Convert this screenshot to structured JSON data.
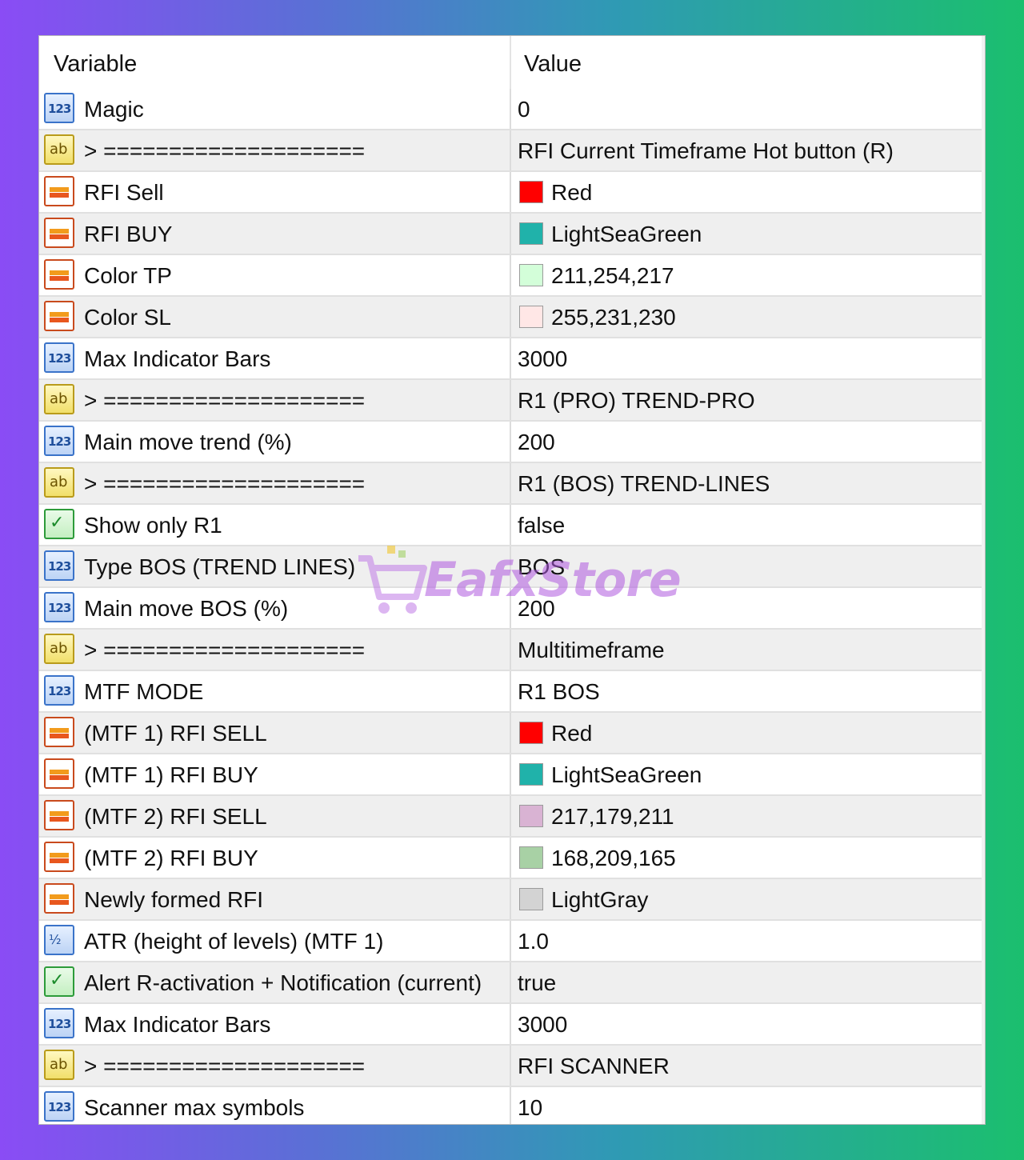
{
  "header": {
    "variable": "Variable",
    "value": "Value"
  },
  "rows": [
    {
      "type": "num",
      "label": "Magic",
      "value": "0"
    },
    {
      "type": "str",
      "label": "> ====================",
      "value": "RFI Current Timeframe Hot button (R)"
    },
    {
      "type": "clr",
      "label": "RFI Sell",
      "value": "Red",
      "swatch": "#ff0000"
    },
    {
      "type": "clr",
      "label": "RFI BUY",
      "value": "LightSeaGreen",
      "swatch": "#20b2aa"
    },
    {
      "type": "clr",
      "label": "Color TP",
      "value": "211,254,217",
      "swatch": "#d3fed9"
    },
    {
      "type": "clr",
      "label": "Color SL",
      "value": "255,231,230",
      "swatch": "#ffe7e6"
    },
    {
      "type": "num",
      "label": "Max Indicator Bars",
      "value": "3000"
    },
    {
      "type": "str",
      "label": "> ====================",
      "value": "R1 (PRO) TREND-PRO"
    },
    {
      "type": "num",
      "label": "Main move trend (%)",
      "value": "200"
    },
    {
      "type": "str",
      "label": "> ====================",
      "value": "R1 (BOS) TREND-LINES"
    },
    {
      "type": "bool",
      "label": "Show only R1",
      "value": "false"
    },
    {
      "type": "num",
      "label": "Type BOS (TREND LINES)",
      "value": "BOS"
    },
    {
      "type": "num",
      "label": "Main move BOS (%)",
      "value": "200"
    },
    {
      "type": "str",
      "label": "> ====================",
      "value": "Multitimeframe"
    },
    {
      "type": "num",
      "label": "MTF  MODE",
      "value": "R1 BOS"
    },
    {
      "type": "clr",
      "label": "(MTF 1) RFI SELL",
      "value": "Red",
      "swatch": "#ff0000"
    },
    {
      "type": "clr",
      "label": "(MTF 1) RFI BUY",
      "value": "LightSeaGreen",
      "swatch": "#20b2aa"
    },
    {
      "type": "clr",
      "label": "(MTF 2) RFI SELL",
      "value": "217,179,211",
      "swatch": "#d9b3d3"
    },
    {
      "type": "clr",
      "label": "(MTF 2) RFI BUY",
      "value": "168,209,165",
      "swatch": "#a8d1a5"
    },
    {
      "type": "clr",
      "label": "Newly formed RFI",
      "value": "LightGray",
      "swatch": "#d3d3d3"
    },
    {
      "type": "dbl",
      "label": "ATR (height of levels) (MTF 1)",
      "value": "1.0"
    },
    {
      "type": "bool",
      "label": "Alert R-activation + Notification (current)",
      "value": "true"
    },
    {
      "type": "num",
      "label": "Max Indicator Bars",
      "value": "3000"
    },
    {
      "type": "str",
      "label": "> ====================",
      "value": "RFI SCANNER"
    },
    {
      "type": "num",
      "label": "Scanner max symbols",
      "value": "10"
    }
  ],
  "icon_glyphs": {
    "num": "123",
    "str": "ab",
    "dbl": "½",
    "bool": "✓"
  },
  "watermark": {
    "text": "EafxStore"
  }
}
